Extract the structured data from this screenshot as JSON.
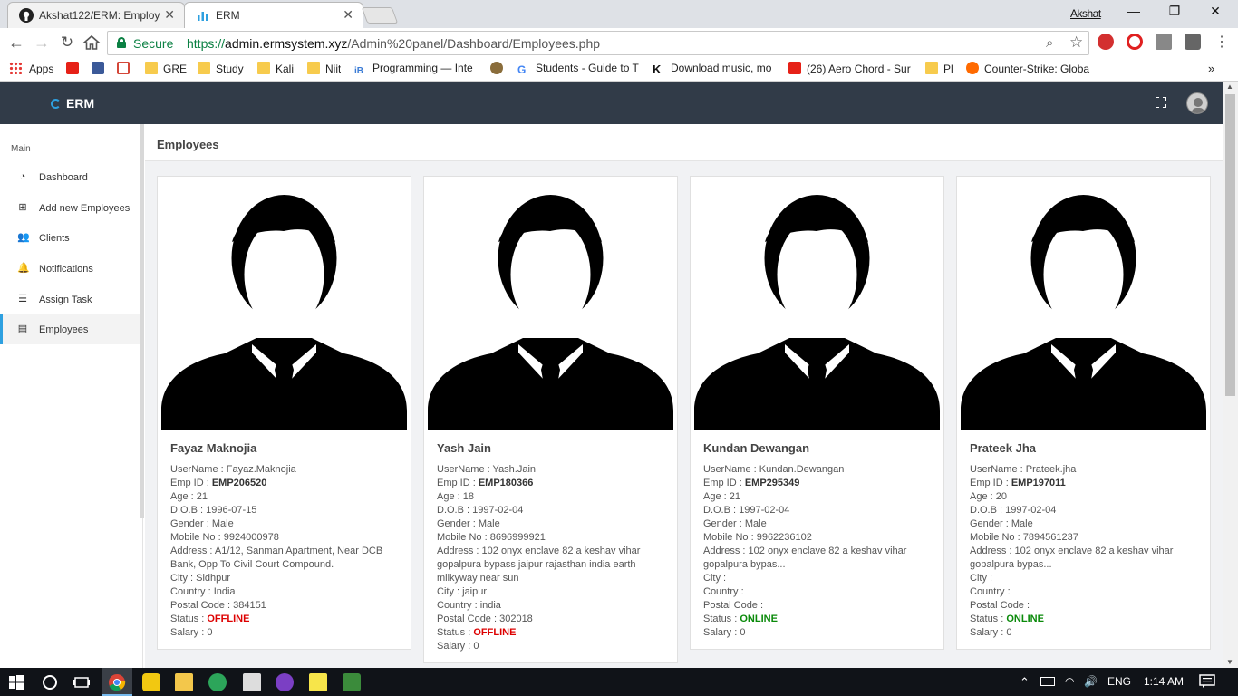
{
  "browser": {
    "tabs": [
      {
        "title": "Akshat122/ERM: Employ",
        "close": "✕",
        "active": false
      },
      {
        "title": "ERM",
        "close": "✕",
        "active": true
      }
    ],
    "profile_name": "Akshat",
    "window_controls": {
      "minimize": "—",
      "maximize": "❐",
      "close": "✕"
    },
    "secure_label": "Secure",
    "url_scheme": "https://",
    "url_host": "admin.ermsystem.xyz",
    "url_path": "/Admin%20panel/Dashboard/Employees.php",
    "bookmarks": [
      {
        "label": "Apps",
        "icon": "apps-grid-icon"
      },
      {
        "label": "",
        "icon": "youtube-icon"
      },
      {
        "label": "",
        "icon": "facebook-icon"
      },
      {
        "label": "",
        "icon": "gmail-icon"
      },
      {
        "label": "GRE",
        "icon": "folder-icon"
      },
      {
        "label": "Study",
        "icon": "folder-icon"
      },
      {
        "label": "Kali",
        "icon": "folder-icon"
      },
      {
        "label": "Niit",
        "icon": "folder-icon"
      },
      {
        "label": "Programming — Inte",
        "icon": "ib-icon"
      },
      {
        "label": "",
        "icon": "shield-icon"
      },
      {
        "label": "Students - Guide to T",
        "icon": "google-icon"
      },
      {
        "label": "Download music, mo",
        "icon": "k-icon"
      },
      {
        "label": "(26) Aero Chord - Sur",
        "icon": "youtube-icon"
      },
      {
        "label": "Pl",
        "icon": "folder-icon"
      },
      {
        "label": "Counter-Strike: Globa",
        "icon": "g-icon"
      }
    ],
    "bookmarks_overflow": "»"
  },
  "app": {
    "brand": "ERM",
    "sidebar": {
      "section": "Main",
      "items": [
        {
          "label": "Dashboard",
          "icon": "dashboard-icon"
        },
        {
          "label": "Add new Employees",
          "icon": "plus-square-icon"
        },
        {
          "label": "Clients",
          "icon": "users-icon"
        },
        {
          "label": "Notifications",
          "icon": "bell-icon"
        },
        {
          "label": "Assign Task",
          "icon": "tasks-icon"
        },
        {
          "label": "Employees",
          "icon": "id-card-icon",
          "active": true
        }
      ]
    },
    "page_title": "Employees",
    "employees": [
      {
        "name": "Fayaz Maknojia",
        "username": "Fayaz.Maknojia",
        "emp_id": "EMP206520",
        "age": "21",
        "dob": "1996-07-15",
        "gender": "Male",
        "mobile": "9924000978",
        "address": "A1/12, Sanman Apartment, Near DCB Bank, Opp To Civil Court Compound.",
        "city": "Sidhpur",
        "country": "India",
        "postal": "384151",
        "status": "OFFLINE",
        "salary": "0"
      },
      {
        "name": "Yash Jain",
        "username": "Yash.Jain",
        "emp_id": "EMP180366",
        "age": "18",
        "dob": "1997-02-04",
        "gender": "Male",
        "mobile": "8696999921",
        "address": "102 onyx enclave 82 a keshav vihar gopalpura bypass jaipur rajasthan india earth milkyway near sun",
        "city": "jaipur",
        "country": "india",
        "postal": "302018",
        "status": "OFFLINE",
        "salary": "0"
      },
      {
        "name": "Kundan Dewangan",
        "username": "Kundan.Dewangan",
        "emp_id": "EMP295349",
        "age": "21",
        "dob": "1997-02-04",
        "gender": "Male",
        "mobile": "9962236102",
        "address": "102 onyx enclave 82 a keshav vihar gopalpura bypas...",
        "city": "",
        "country": "",
        "postal": "",
        "status": "ONLINE",
        "salary": "0"
      },
      {
        "name": "Prateek Jha",
        "username": "Prateek.jha",
        "emp_id": "EMP197011",
        "age": "20",
        "dob": "1997-02-04",
        "gender": "Male",
        "mobile": "7894561237",
        "address": "102 onyx enclave 82 a keshav vihar gopalpura bypas...",
        "city": "",
        "country": "",
        "postal": "",
        "status": "ONLINE",
        "salary": "0"
      }
    ],
    "labels": {
      "username": "UserName : ",
      "emp_id": "Emp ID : ",
      "age": "Age : ",
      "dob": "D.O.B : ",
      "gender": "Gender : ",
      "mobile": "Mobile No : ",
      "address": "Address : ",
      "city": "City : ",
      "country": "Country : ",
      "postal": "Postal Code : ",
      "status": "Status : ",
      "salary": "Salary : "
    },
    "colors": {
      "header_bg": "#313b48",
      "accent": "#2ea0e0",
      "offline": "#dd0000",
      "online": "#0a8a0a"
    }
  },
  "taskbar": {
    "language": "ENG",
    "time": "1:14 AM"
  }
}
